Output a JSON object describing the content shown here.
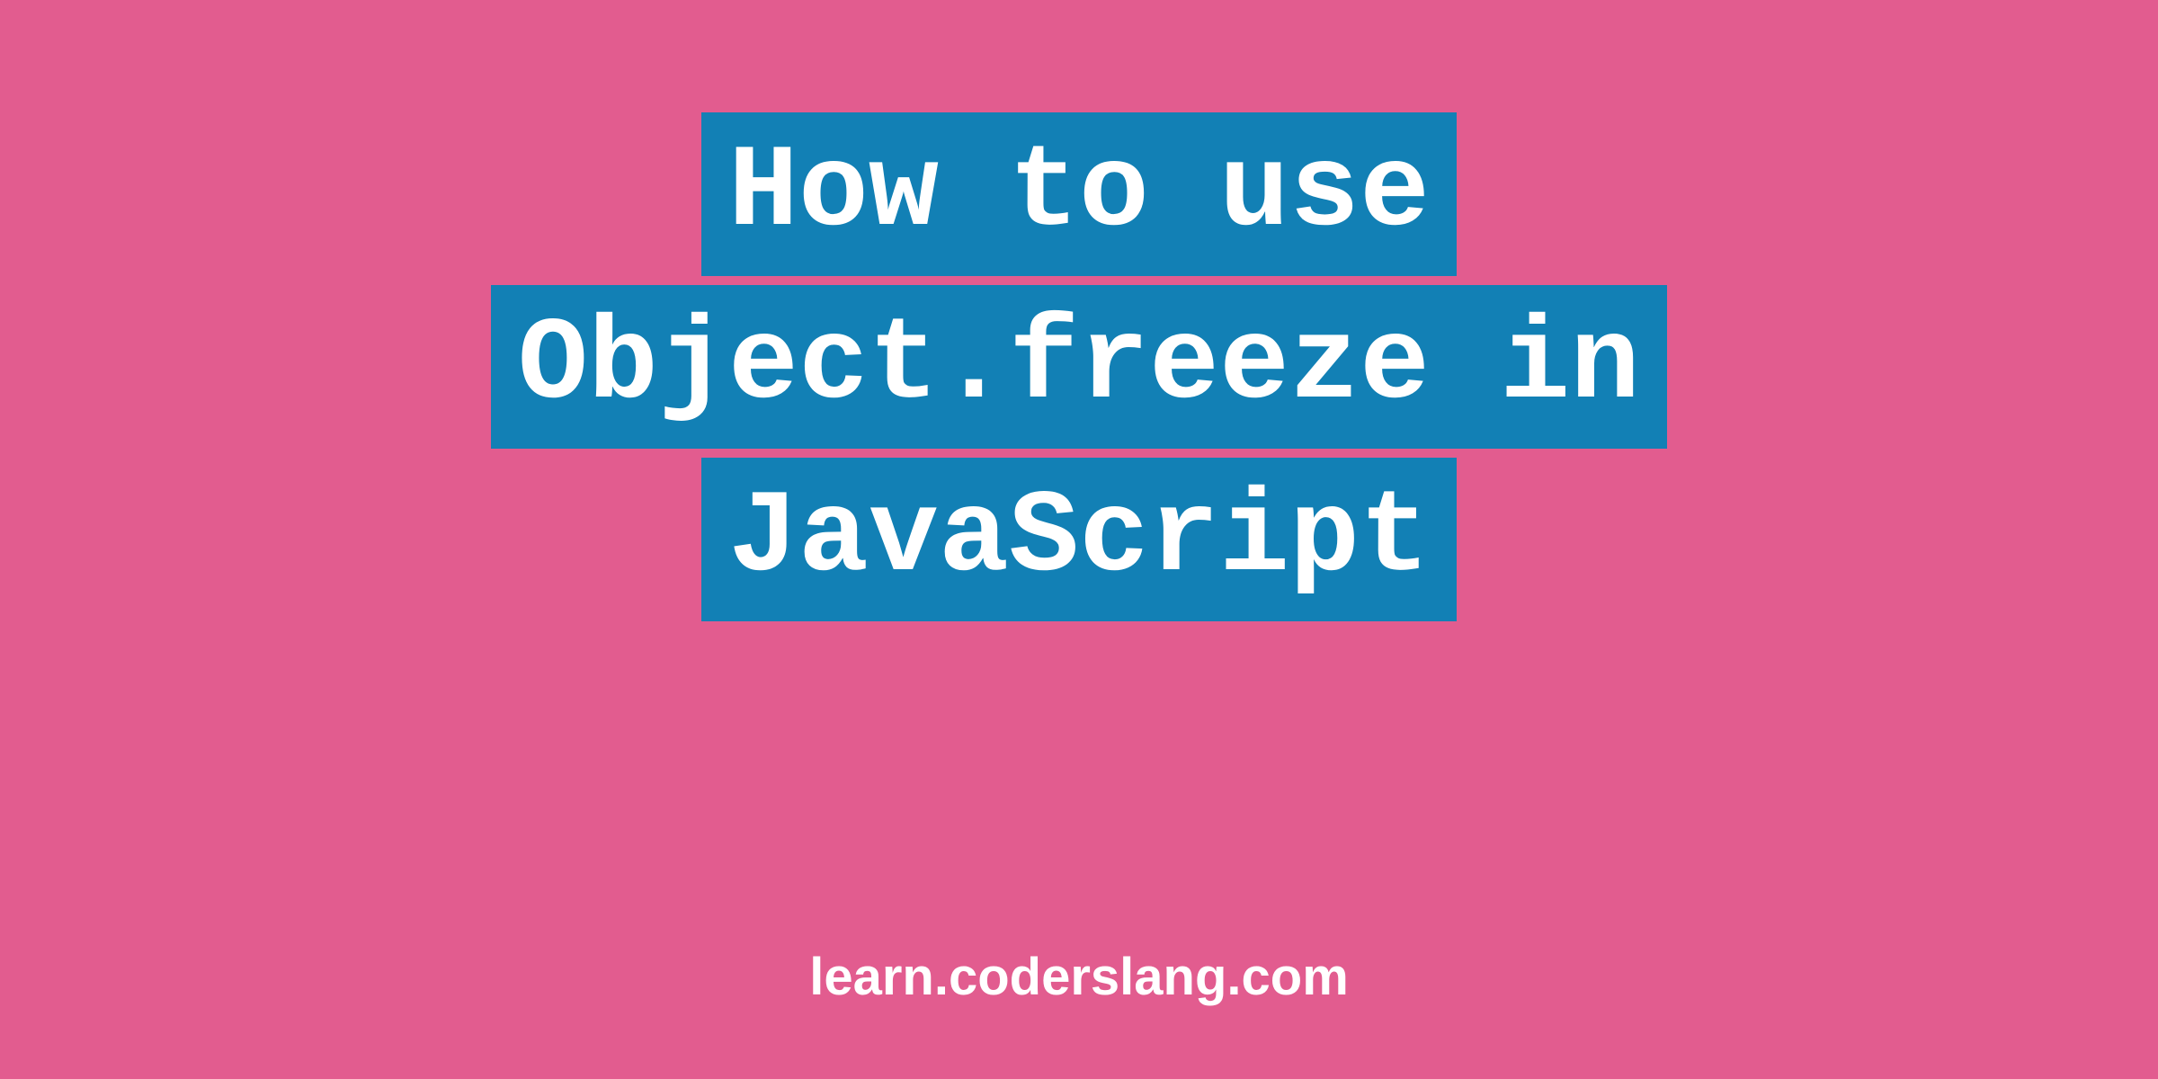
{
  "title": {
    "line1": "How to use",
    "line2": "Object.freeze in",
    "line3": "JavaScript"
  },
  "footer": {
    "url": "learn.coderslang.com"
  },
  "colors": {
    "background": "#e25c8f",
    "highlight": "#1280b5",
    "text": "#ffffff"
  }
}
